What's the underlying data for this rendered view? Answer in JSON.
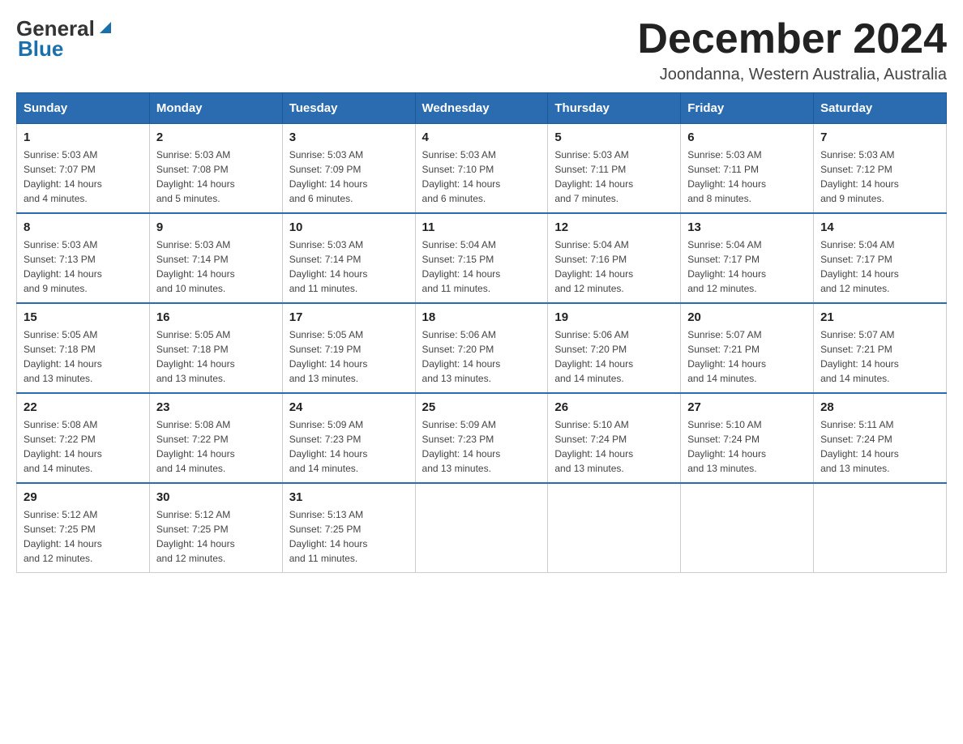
{
  "header": {
    "logo_general": "General",
    "logo_blue": "Blue",
    "month_year": "December 2024",
    "location": "Joondanna, Western Australia, Australia"
  },
  "days_of_week": [
    "Sunday",
    "Monday",
    "Tuesday",
    "Wednesday",
    "Thursday",
    "Friday",
    "Saturday"
  ],
  "weeks": [
    [
      {
        "day": "1",
        "sunrise": "5:03 AM",
        "sunset": "7:07 PM",
        "daylight": "14 hours and 4 minutes."
      },
      {
        "day": "2",
        "sunrise": "5:03 AM",
        "sunset": "7:08 PM",
        "daylight": "14 hours and 5 minutes."
      },
      {
        "day": "3",
        "sunrise": "5:03 AM",
        "sunset": "7:09 PM",
        "daylight": "14 hours and 6 minutes."
      },
      {
        "day": "4",
        "sunrise": "5:03 AM",
        "sunset": "7:10 PM",
        "daylight": "14 hours and 6 minutes."
      },
      {
        "day": "5",
        "sunrise": "5:03 AM",
        "sunset": "7:11 PM",
        "daylight": "14 hours and 7 minutes."
      },
      {
        "day": "6",
        "sunrise": "5:03 AM",
        "sunset": "7:11 PM",
        "daylight": "14 hours and 8 minutes."
      },
      {
        "day": "7",
        "sunrise": "5:03 AM",
        "sunset": "7:12 PM",
        "daylight": "14 hours and 9 minutes."
      }
    ],
    [
      {
        "day": "8",
        "sunrise": "5:03 AM",
        "sunset": "7:13 PM",
        "daylight": "14 hours and 9 minutes."
      },
      {
        "day": "9",
        "sunrise": "5:03 AM",
        "sunset": "7:14 PM",
        "daylight": "14 hours and 10 minutes."
      },
      {
        "day": "10",
        "sunrise": "5:03 AM",
        "sunset": "7:14 PM",
        "daylight": "14 hours and 11 minutes."
      },
      {
        "day": "11",
        "sunrise": "5:04 AM",
        "sunset": "7:15 PM",
        "daylight": "14 hours and 11 minutes."
      },
      {
        "day": "12",
        "sunrise": "5:04 AM",
        "sunset": "7:16 PM",
        "daylight": "14 hours and 12 minutes."
      },
      {
        "day": "13",
        "sunrise": "5:04 AM",
        "sunset": "7:17 PM",
        "daylight": "14 hours and 12 minutes."
      },
      {
        "day": "14",
        "sunrise": "5:04 AM",
        "sunset": "7:17 PM",
        "daylight": "14 hours and 12 minutes."
      }
    ],
    [
      {
        "day": "15",
        "sunrise": "5:05 AM",
        "sunset": "7:18 PM",
        "daylight": "14 hours and 13 minutes."
      },
      {
        "day": "16",
        "sunrise": "5:05 AM",
        "sunset": "7:18 PM",
        "daylight": "14 hours and 13 minutes."
      },
      {
        "day": "17",
        "sunrise": "5:05 AM",
        "sunset": "7:19 PM",
        "daylight": "14 hours and 13 minutes."
      },
      {
        "day": "18",
        "sunrise": "5:06 AM",
        "sunset": "7:20 PM",
        "daylight": "14 hours and 13 minutes."
      },
      {
        "day": "19",
        "sunrise": "5:06 AM",
        "sunset": "7:20 PM",
        "daylight": "14 hours and 14 minutes."
      },
      {
        "day": "20",
        "sunrise": "5:07 AM",
        "sunset": "7:21 PM",
        "daylight": "14 hours and 14 minutes."
      },
      {
        "day": "21",
        "sunrise": "5:07 AM",
        "sunset": "7:21 PM",
        "daylight": "14 hours and 14 minutes."
      }
    ],
    [
      {
        "day": "22",
        "sunrise": "5:08 AM",
        "sunset": "7:22 PM",
        "daylight": "14 hours and 14 minutes."
      },
      {
        "day": "23",
        "sunrise": "5:08 AM",
        "sunset": "7:22 PM",
        "daylight": "14 hours and 14 minutes."
      },
      {
        "day": "24",
        "sunrise": "5:09 AM",
        "sunset": "7:23 PM",
        "daylight": "14 hours and 14 minutes."
      },
      {
        "day": "25",
        "sunrise": "5:09 AM",
        "sunset": "7:23 PM",
        "daylight": "14 hours and 13 minutes."
      },
      {
        "day": "26",
        "sunrise": "5:10 AM",
        "sunset": "7:24 PM",
        "daylight": "14 hours and 13 minutes."
      },
      {
        "day": "27",
        "sunrise": "5:10 AM",
        "sunset": "7:24 PM",
        "daylight": "14 hours and 13 minutes."
      },
      {
        "day": "28",
        "sunrise": "5:11 AM",
        "sunset": "7:24 PM",
        "daylight": "14 hours and 13 minutes."
      }
    ],
    [
      {
        "day": "29",
        "sunrise": "5:12 AM",
        "sunset": "7:25 PM",
        "daylight": "14 hours and 12 minutes."
      },
      {
        "day": "30",
        "sunrise": "5:12 AM",
        "sunset": "7:25 PM",
        "daylight": "14 hours and 12 minutes."
      },
      {
        "day": "31",
        "sunrise": "5:13 AM",
        "sunset": "7:25 PM",
        "daylight": "14 hours and 11 minutes."
      },
      null,
      null,
      null,
      null
    ]
  ]
}
